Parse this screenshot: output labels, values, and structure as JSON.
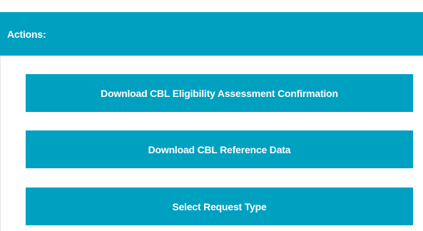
{
  "panel": {
    "title": "Actions:"
  },
  "actions": {
    "download_eligibility_label": "Download CBL Eligibility Assessment Confirmation",
    "download_reference_label": "Download CBL Reference Data",
    "select_request_type_label": "Select Request Type"
  },
  "colors": {
    "accent": "#00a0c1",
    "text_on_accent": "#ffffff"
  }
}
